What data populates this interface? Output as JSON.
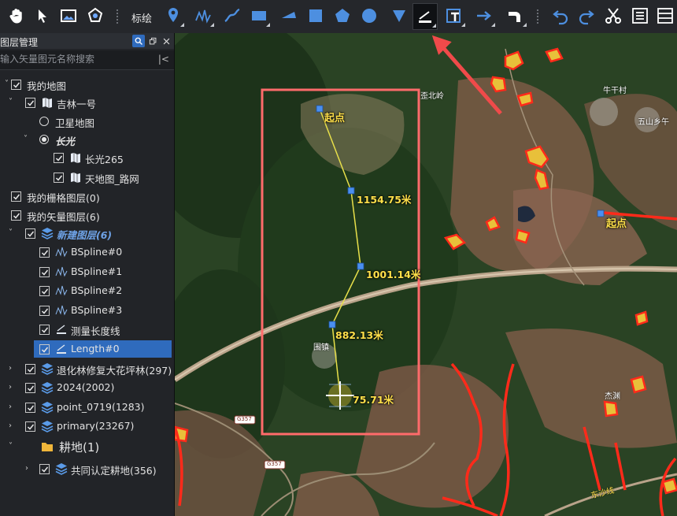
{
  "toolbar": {
    "draw_label": "标绘",
    "tools": [
      "pan-hand",
      "select-arrow",
      "image-map",
      "edit-polygon",
      "point-pin",
      "freehand-line",
      "curve-line",
      "rectangle",
      "sector",
      "square",
      "pentagon",
      "circle",
      "pin-shape",
      "measure-length",
      "text-box",
      "arrow-line",
      "bend-arrow",
      "undo",
      "redo",
      "cut",
      "list-view",
      "table-view"
    ],
    "active_tool": "measure-length"
  },
  "panel": {
    "title": "图层管理",
    "search_placeholder": "输入矢量图元名称搜索",
    "collapse_glyph": "|<"
  },
  "tree": [
    {
      "label": "我的地图",
      "checked": true,
      "expand": "down"
    },
    {
      "label": "吉林一号",
      "checked": true,
      "expand": "down",
      "icon": "map-icon"
    },
    {
      "label": "卫星地图",
      "radio": false
    },
    {
      "label": "长光",
      "radio": true,
      "expand": "down",
      "style": "bold-italic"
    },
    {
      "label": "长光265",
      "checked": true,
      "icon": "map-icon"
    },
    {
      "label": "天地图_路网",
      "checked": true,
      "icon": "map-icon"
    },
    {
      "label": "我的栅格图层(0)",
      "checked": true
    },
    {
      "label": "我的矢量图层(6)",
      "checked": true
    },
    {
      "label": "新建图层(6)",
      "checked": true,
      "expand": "down",
      "icon": "layers-icon",
      "style": "bold-italic-blue"
    },
    {
      "label": "BSpline#0",
      "checked": true,
      "icon": "spline-icon"
    },
    {
      "label": "BSpline#1",
      "checked": true,
      "icon": "spline-icon"
    },
    {
      "label": "BSpline#2",
      "checked": true,
      "icon": "spline-icon"
    },
    {
      "label": "BSpline#3",
      "checked": true,
      "icon": "spline-icon"
    },
    {
      "label": "测量长度线",
      "checked": true,
      "icon": "measure-icon"
    },
    {
      "label": "Length#0",
      "checked": true,
      "icon": "measure-icon",
      "selected": true
    },
    {
      "label": "退化林修复大花坪林(297)",
      "checked": true,
      "expand": "right",
      "icon": "layers-icon"
    },
    {
      "label": "2024(2002)",
      "checked": true,
      "expand": "right",
      "icon": "layers-icon"
    },
    {
      "label": "point_0719(1283)",
      "checked": true,
      "expand": "right",
      "icon": "layers-icon"
    },
    {
      "label": "primary(23267)",
      "checked": true,
      "expand": "right",
      "icon": "layers-icon"
    },
    {
      "label": "耕地(1)",
      "expand": "down",
      "icon": "folder-icon",
      "style": "large"
    },
    {
      "label": "共同认定耕地(356)",
      "checked": true,
      "expand": "right",
      "icon": "layers-icon"
    }
  ],
  "map": {
    "start_label": "起点",
    "start_label_2": "起点",
    "segments": [
      "1154.75米",
      "1001.14米",
      "882.13米",
      "75.71米"
    ],
    "places": [
      "歪北岭",
      "牛干村",
      "五山乡午",
      "围镇",
      "杰渊",
      "东沙线"
    ],
    "road_shields": [
      "G357",
      "G357"
    ],
    "colors": {
      "measure": "#e8e04a",
      "highlight": "#ff6b6b",
      "parcel": "#ff2a1a",
      "select": "#2f6bbd"
    }
  }
}
